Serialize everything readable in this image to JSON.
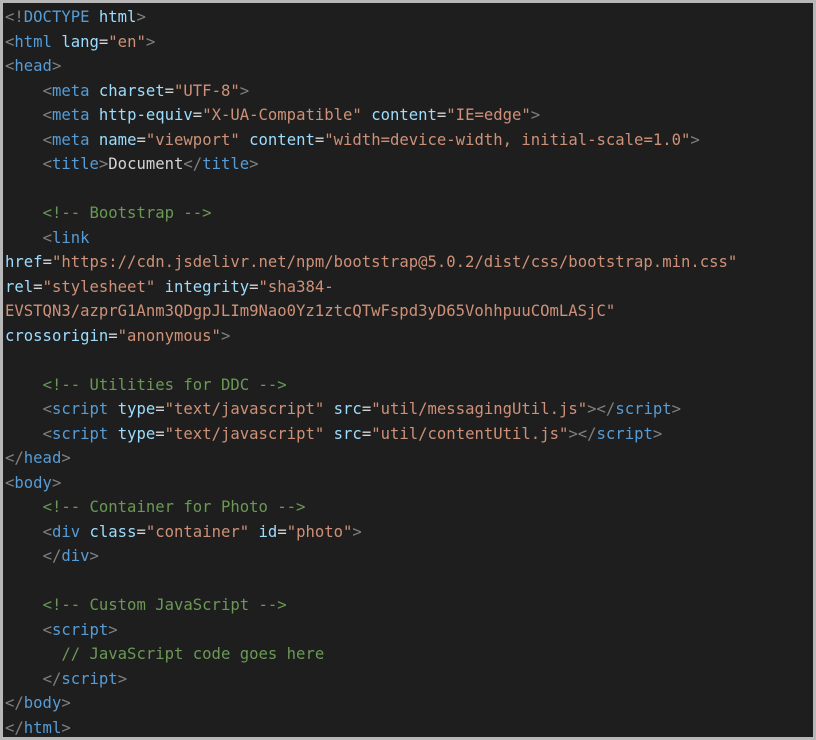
{
  "editor": {
    "language": "html",
    "colors": {
      "background": "#1e1e1e",
      "border": "#b8b8b8",
      "punct": "#808080",
      "tag": "#569cd6",
      "attr": "#9cdcfe",
      "string": "#ce9178",
      "comment": "#6a9955",
      "text": "#d4d4d4"
    },
    "lines": [
      [
        [
          "punct",
          "<!"
        ],
        [
          "kw",
          "DOCTYPE"
        ],
        [
          "text",
          " "
        ],
        [
          "attr",
          "html"
        ],
        [
          "punct",
          ">"
        ]
      ],
      [
        [
          "punct",
          "<"
        ],
        [
          "tag",
          "html"
        ],
        [
          "text",
          " "
        ],
        [
          "attr",
          "lang"
        ],
        [
          "text",
          "="
        ],
        [
          "str",
          "\"en\""
        ],
        [
          "punct",
          ">"
        ]
      ],
      [
        [
          "punct",
          "<"
        ],
        [
          "tag",
          "head"
        ],
        [
          "punct",
          ">"
        ]
      ],
      [
        [
          "text",
          "    "
        ],
        [
          "punct",
          "<"
        ],
        [
          "tag",
          "meta"
        ],
        [
          "text",
          " "
        ],
        [
          "attr",
          "charset"
        ],
        [
          "text",
          "="
        ],
        [
          "str",
          "\"UTF-8\""
        ],
        [
          "punct",
          ">"
        ]
      ],
      [
        [
          "text",
          "    "
        ],
        [
          "punct",
          "<"
        ],
        [
          "tag",
          "meta"
        ],
        [
          "text",
          " "
        ],
        [
          "attr",
          "http-equiv"
        ],
        [
          "text",
          "="
        ],
        [
          "str",
          "\"X-UA-Compatible\""
        ],
        [
          "text",
          " "
        ],
        [
          "attr",
          "content"
        ],
        [
          "text",
          "="
        ],
        [
          "str",
          "\"IE=edge\""
        ],
        [
          "punct",
          ">"
        ]
      ],
      [
        [
          "text",
          "    "
        ],
        [
          "punct",
          "<"
        ],
        [
          "tag",
          "meta"
        ],
        [
          "text",
          " "
        ],
        [
          "attr",
          "name"
        ],
        [
          "text",
          "="
        ],
        [
          "str",
          "\"viewport\""
        ],
        [
          "text",
          " "
        ],
        [
          "attr",
          "content"
        ],
        [
          "text",
          "="
        ],
        [
          "str",
          "\"width=device-width, initial-scale=1.0\""
        ],
        [
          "punct",
          ">"
        ]
      ],
      [
        [
          "text",
          "    "
        ],
        [
          "punct",
          "<"
        ],
        [
          "tag",
          "title"
        ],
        [
          "punct",
          ">"
        ],
        [
          "text",
          "Document"
        ],
        [
          "punct",
          "</"
        ],
        [
          "tag",
          "title"
        ],
        [
          "punct",
          ">"
        ]
      ],
      [],
      [
        [
          "text",
          "    "
        ],
        [
          "cmt",
          "<!-- Bootstrap -->"
        ]
      ],
      [
        [
          "text",
          "    "
        ],
        [
          "punct",
          "<"
        ],
        [
          "tag",
          "link"
        ]
      ],
      [
        [
          "attr",
          "href"
        ],
        [
          "text",
          "="
        ],
        [
          "str",
          "\"https://cdn.jsdelivr.net/npm/bootstrap@5.0.2/dist/css/bootstrap.min.css\""
        ]
      ],
      [
        [
          "attr",
          "rel"
        ],
        [
          "text",
          "="
        ],
        [
          "str",
          "\"stylesheet\""
        ],
        [
          "text",
          " "
        ],
        [
          "attr",
          "integrity"
        ],
        [
          "text",
          "="
        ],
        [
          "str",
          "\"sha384-"
        ]
      ],
      [
        [
          "str",
          "EVSTQN3/azprG1Anm3QDgpJLIm9Nao0Yz1ztcQTwFspd3yD65VohhpuuCOmLASjC\""
        ]
      ],
      [
        [
          "attr",
          "crossorigin"
        ],
        [
          "text",
          "="
        ],
        [
          "str",
          "\"anonymous\""
        ],
        [
          "punct",
          ">"
        ]
      ],
      [],
      [
        [
          "text",
          "    "
        ],
        [
          "cmt",
          "<!-- Utilities for DDC -->"
        ]
      ],
      [
        [
          "text",
          "    "
        ],
        [
          "punct",
          "<"
        ],
        [
          "tag",
          "script"
        ],
        [
          "text",
          " "
        ],
        [
          "attr",
          "type"
        ],
        [
          "text",
          "="
        ],
        [
          "str",
          "\"text/javascript\""
        ],
        [
          "text",
          " "
        ],
        [
          "attr",
          "src"
        ],
        [
          "text",
          "="
        ],
        [
          "str",
          "\"util/messagingUtil.js\""
        ],
        [
          "punct",
          "></"
        ],
        [
          "tag",
          "script"
        ],
        [
          "punct",
          ">"
        ]
      ],
      [
        [
          "text",
          "    "
        ],
        [
          "punct",
          "<"
        ],
        [
          "tag",
          "script"
        ],
        [
          "text",
          " "
        ],
        [
          "attr",
          "type"
        ],
        [
          "text",
          "="
        ],
        [
          "str",
          "\"text/javascript\""
        ],
        [
          "text",
          " "
        ],
        [
          "attr",
          "src"
        ],
        [
          "text",
          "="
        ],
        [
          "str",
          "\"util/contentUtil.js\""
        ],
        [
          "punct",
          "></"
        ],
        [
          "tag",
          "script"
        ],
        [
          "punct",
          ">"
        ]
      ],
      [
        [
          "punct",
          "</"
        ],
        [
          "tag",
          "head"
        ],
        [
          "punct",
          ">"
        ]
      ],
      [
        [
          "punct",
          "<"
        ],
        [
          "tag",
          "body"
        ],
        [
          "punct",
          ">"
        ]
      ],
      [
        [
          "text",
          "    "
        ],
        [
          "cmt",
          "<!-- Container for Photo -->"
        ]
      ],
      [
        [
          "text",
          "    "
        ],
        [
          "punct",
          "<"
        ],
        [
          "tag",
          "div"
        ],
        [
          "text",
          " "
        ],
        [
          "attr",
          "class"
        ],
        [
          "text",
          "="
        ],
        [
          "str",
          "\"container\""
        ],
        [
          "text",
          " "
        ],
        [
          "attr",
          "id"
        ],
        [
          "text",
          "="
        ],
        [
          "str",
          "\"photo\""
        ],
        [
          "punct",
          ">"
        ]
      ],
      [
        [
          "text",
          "    "
        ],
        [
          "punct",
          "</"
        ],
        [
          "tag",
          "div"
        ],
        [
          "punct",
          ">"
        ]
      ],
      [],
      [
        [
          "text",
          "    "
        ],
        [
          "cmt",
          "<!-- Custom JavaScript -->"
        ]
      ],
      [
        [
          "text",
          "    "
        ],
        [
          "punct",
          "<"
        ],
        [
          "tag",
          "script"
        ],
        [
          "punct",
          ">"
        ]
      ],
      [
        [
          "text",
          "      "
        ],
        [
          "cmt",
          "// JavaScript code goes here"
        ]
      ],
      [
        [
          "text",
          "    "
        ],
        [
          "punct",
          "</"
        ],
        [
          "tag",
          "script"
        ],
        [
          "punct",
          ">"
        ]
      ],
      [
        [
          "punct",
          "</"
        ],
        [
          "tag",
          "body"
        ],
        [
          "punct",
          ">"
        ]
      ],
      [
        [
          "punct",
          "</"
        ],
        [
          "tag",
          "html"
        ],
        [
          "punct",
          ">"
        ]
      ]
    ]
  }
}
